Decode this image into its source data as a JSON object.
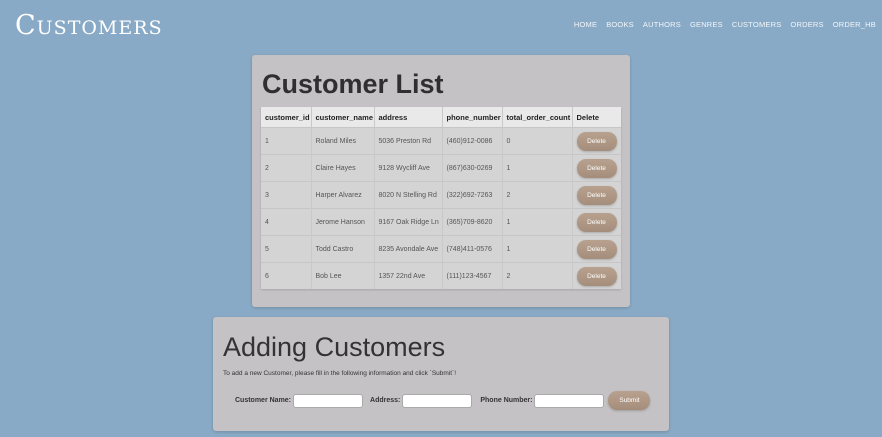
{
  "site": {
    "title": "Customers"
  },
  "nav": {
    "items": [
      "HOME",
      "BOOKS",
      "AUTHORS",
      "GENRES",
      "CUSTOMERS",
      "ORDERS",
      "ORDER_HB"
    ]
  },
  "customer_list": {
    "heading": "Customer List",
    "columns": [
      "customer_id",
      "customer_name",
      "address",
      "phone_number",
      "total_order_count",
      "Delete"
    ],
    "delete_label": "Delete",
    "rows": [
      {
        "id": "1",
        "name": "Roland Miles",
        "address": "5036 Preston Rd",
        "phone": "(460)912-0086",
        "count": "0"
      },
      {
        "id": "2",
        "name": "Claire Hayes",
        "address": "9128 Wycliff Ave",
        "phone": "(867)630-0269",
        "count": "1"
      },
      {
        "id": "3",
        "name": "Harper Alvarez",
        "address": "8020 N Stelling Rd",
        "phone": "(322)692-7263",
        "count": "2"
      },
      {
        "id": "4",
        "name": "Jerome Hanson",
        "address": "9167 Oak Ridge Ln",
        "phone": "(365)709-8620",
        "count": "1"
      },
      {
        "id": "5",
        "name": "Todd Castro",
        "address": "8235 Avondale Ave",
        "phone": "(748)411-0576",
        "count": "1"
      },
      {
        "id": "6",
        "name": "Bob Lee",
        "address": "1357 22nd Ave",
        "phone": "(111)123-4567",
        "count": "2"
      }
    ]
  },
  "add_customer": {
    "heading": "Adding Customers",
    "description": "To add a new Customer, please fill in the following information and click `Submit`!",
    "name_label": "Customer Name:",
    "name_value": "",
    "address_label": "Address:",
    "address_value": "",
    "phone_label": "Phone Number:",
    "phone_value": "",
    "submit_label": "Submit"
  }
}
